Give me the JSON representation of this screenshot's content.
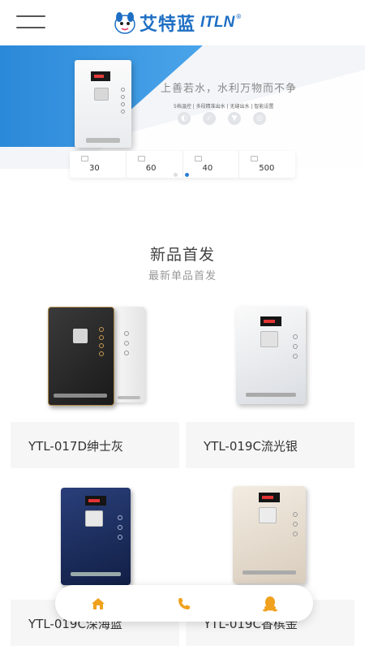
{
  "header": {
    "logo_cn": "艾特蓝",
    "logo_en": "ITLN",
    "logo_reg": "®"
  },
  "banner": {
    "slogan": "上善若水，水利万物而不争",
    "features": "5档温控 | 多段精准出水 | 无缝出水 | 智能设置",
    "stats": [
      {
        "value": "30"
      },
      {
        "value": "60"
      },
      {
        "value": "40"
      },
      {
        "value": "500"
      }
    ],
    "slides": 2,
    "active_slide": 2
  },
  "section": {
    "title": "新品首发",
    "subtitle": "最新单品首发"
  },
  "products": [
    {
      "name": "YTL-017D绅士灰"
    },
    {
      "name": "YTL-019C流光银"
    },
    {
      "name": "YTL-019C深海蓝"
    },
    {
      "name": "YTL-019C香槟金"
    }
  ],
  "bottom_nav": [
    {
      "icon": "home-icon"
    },
    {
      "icon": "phone-icon"
    },
    {
      "icon": "qq-icon"
    }
  ],
  "colors": {
    "brand": "#1e6fc4",
    "banner_blue": "#2b89d9",
    "nav_icon": "#f0a21e"
  }
}
